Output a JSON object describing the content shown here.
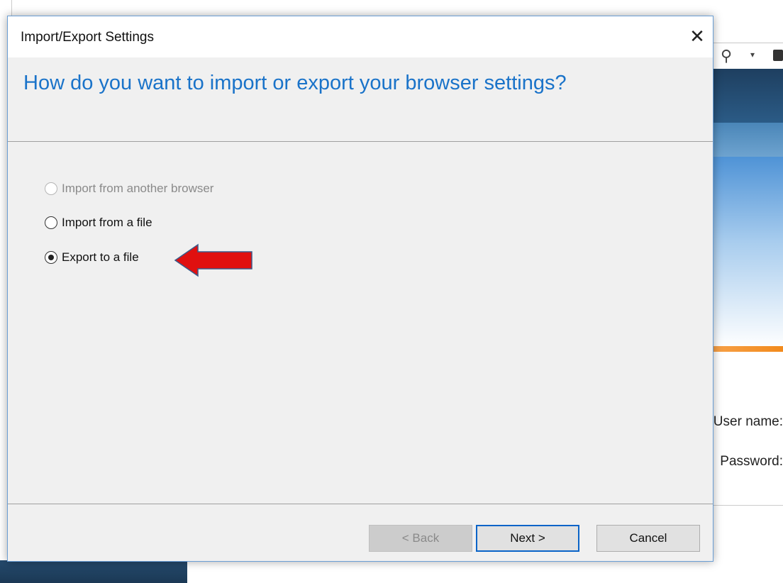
{
  "dialog": {
    "title": "Import/Export Settings",
    "close_glyph": "✕",
    "heading": "How do you want to import or export your browser settings?",
    "options": [
      {
        "label": "Import from another browser",
        "checked": false,
        "disabled": true
      },
      {
        "label": "Import from a file",
        "checked": false,
        "disabled": false
      },
      {
        "label": "Export to a file",
        "checked": true,
        "disabled": false
      }
    ],
    "buttons": {
      "back": "< Back",
      "next": "Next >",
      "cancel": "Cancel"
    }
  },
  "background": {
    "search_glyph": "⚲",
    "dropdown_glyph": "▾",
    "labels": {
      "username": "User name:",
      "password": "Password:"
    }
  },
  "colors": {
    "heading": "#1a73c9",
    "arrow": "#e01010",
    "accent_border": "#0a64c8"
  }
}
